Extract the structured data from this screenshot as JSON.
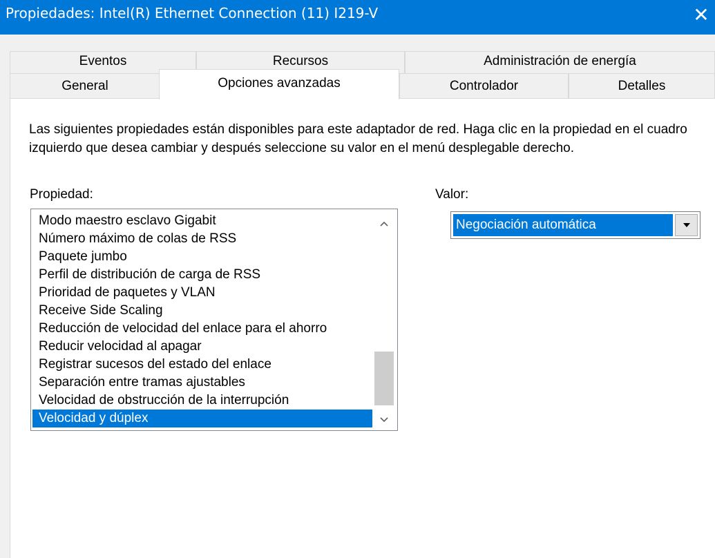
{
  "window": {
    "title": "Propiedades: Intel(R) Ethernet Connection (11) I219-V",
    "close_glyph": "✕"
  },
  "tabs": {
    "row_back": [
      {
        "label": "Eventos"
      },
      {
        "label": "Recursos"
      },
      {
        "label": "Administración de energía"
      }
    ],
    "row_front": [
      {
        "label": "General"
      },
      {
        "label": "Opciones avanzadas",
        "active": true
      },
      {
        "label": "Controlador"
      },
      {
        "label": "Detalles"
      }
    ]
  },
  "panel": {
    "description": "Las siguientes propiedades están disponibles para este adaptador de red. Haga clic en la propiedad en el cuadro izquierdo que desea cambiar y después seleccione su valor en el menú desplegable derecho.",
    "property_label": "Propiedad:",
    "value_label": "Valor:",
    "properties": [
      "Modo maestro esclavo Gigabit",
      "Número máximo de colas de RSS",
      "Paquete jumbo",
      "Perfil de distribución de carga de RSS",
      "Prioridad de paquetes y VLAN",
      "Receive Side Scaling",
      "Reducción de velocidad del enlace para el ahorro",
      "Reducir velocidad al apagar",
      "Registrar sucesos del estado del enlace",
      "Separación entre tramas ajustables",
      "Velocidad de obstrucción de la interrupción",
      "Velocidad y dúplex"
    ],
    "selected_property": "Velocidad y dúplex",
    "value_selected": "Negociación automática"
  },
  "icons": {
    "scroll_up": "chevron-up-icon",
    "scroll_down": "chevron-down-icon",
    "dropdown": "dropdown-arrow-icon"
  },
  "colors": {
    "titlebar": "#0078d7",
    "selection": "#0078d7"
  }
}
